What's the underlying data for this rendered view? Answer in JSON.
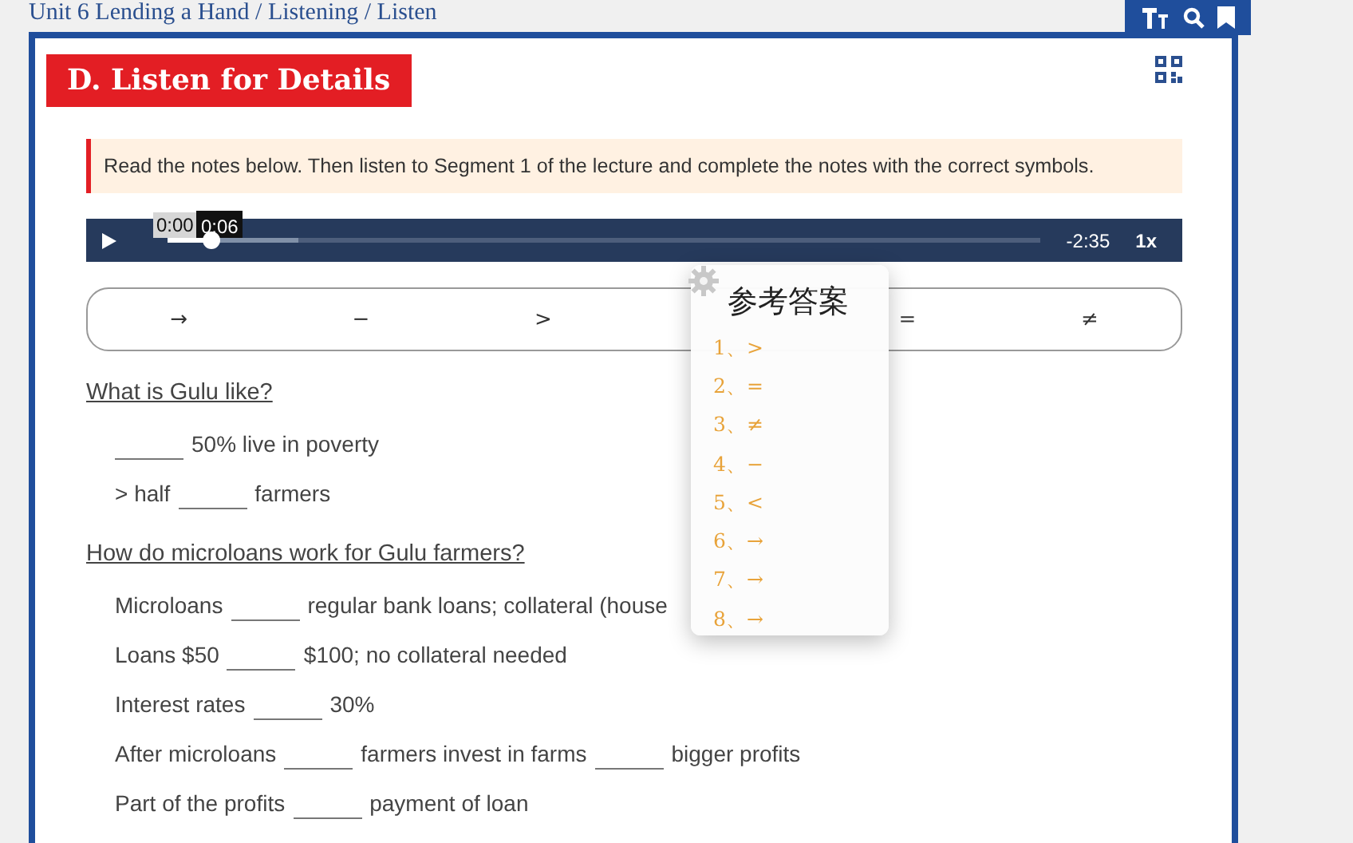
{
  "breadcrumb": "Unit 6 Lending a Hand / Listening / Listen",
  "title": "D. Listen for Details",
  "instruction": "Read the notes below. Then listen to Segment 1 of the lecture and complete the notes with the correct symbols.",
  "audio": {
    "time": "0:00",
    "tooltip": "0:06",
    "remaining": "-2:35",
    "speed": "1x",
    "level": 0.05
  },
  "symbols": [
    "→",
    "−",
    ">",
    "=",
    "≠"
  ],
  "sections": [
    {
      "heading": "What is Gulu like?",
      "lines": [
        {
          "lead_blank": true,
          "parts": [
            "50% live in poverty"
          ]
        },
        {
          "parts": [
            "> half",
            "farmers"
          ]
        }
      ]
    },
    {
      "heading": "How do microloans work for Gulu farmers?",
      "lines": [
        {
          "parts": [
            "Microloans",
            "regular bank loans; collateral (house"
          ]
        },
        {
          "parts": [
            "Loans $50",
            "$100; no collateral needed"
          ]
        },
        {
          "parts": [
            "Interest rates",
            "30%"
          ]
        },
        {
          "parts": [
            "After microloans",
            "farmers invest in farms",
            "bigger profits"
          ]
        },
        {
          "parts": [
            "Part of the profits",
            "payment of loan"
          ]
        }
      ]
    }
  ],
  "answers_popup": {
    "title": "参考答案",
    "answers": [
      "1、>",
      "2、=",
      "3、≠",
      "4、−",
      "5、<",
      "6、→",
      "7、→",
      "8、→"
    ]
  }
}
